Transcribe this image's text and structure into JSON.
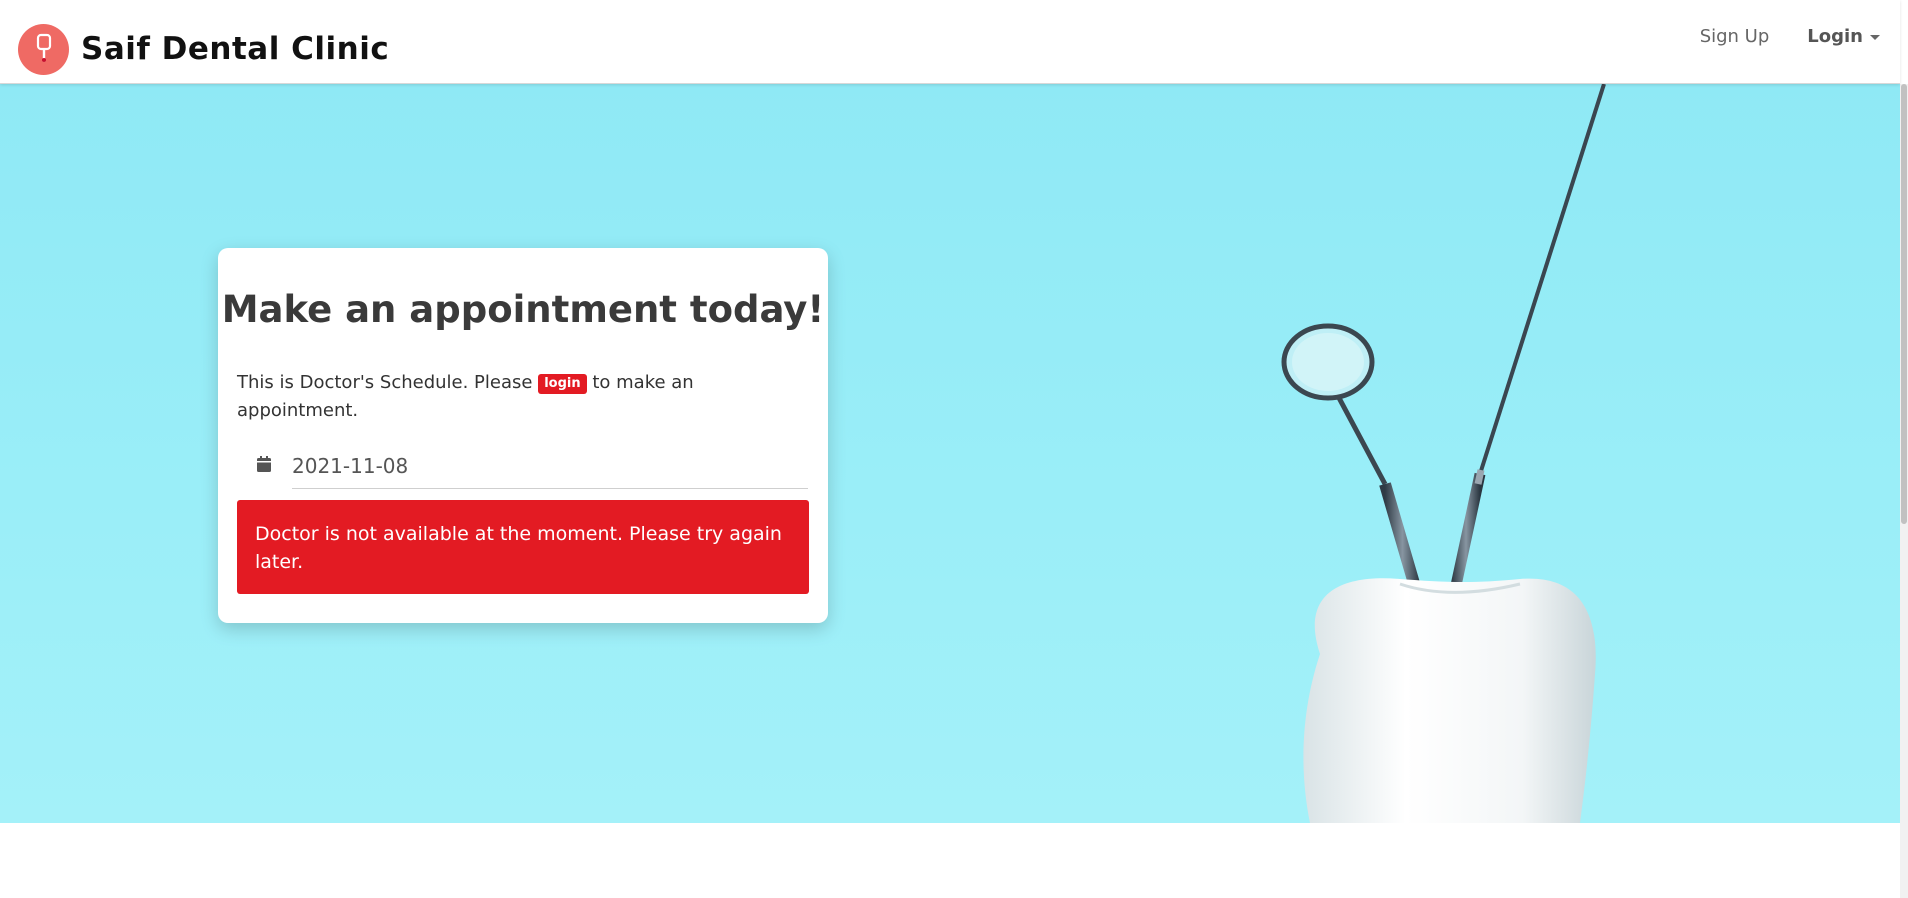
{
  "navbar": {
    "brand_name": "Saif Dental Clinic",
    "logo_icon": "tooth-brush-icon",
    "links": {
      "sign_up": "Sign Up",
      "login": "Login"
    }
  },
  "hero": {
    "illustration": "tooth-with-dental-tools"
  },
  "appointment_card": {
    "title": "Make an appointment today!",
    "text_before": "This is Doctor's Schedule. Please",
    "login_badge": "login",
    "text_after": "to make an appointment.",
    "date_icon": "calendar-icon",
    "date_value": "2021-11-08",
    "alert_message": "Doctor is not available at the moment. Please try again later."
  },
  "colors": {
    "brand_logo_bg": "#ef6a64",
    "alert_red": "#e31b23",
    "hero_bg": "#9aeef8"
  }
}
